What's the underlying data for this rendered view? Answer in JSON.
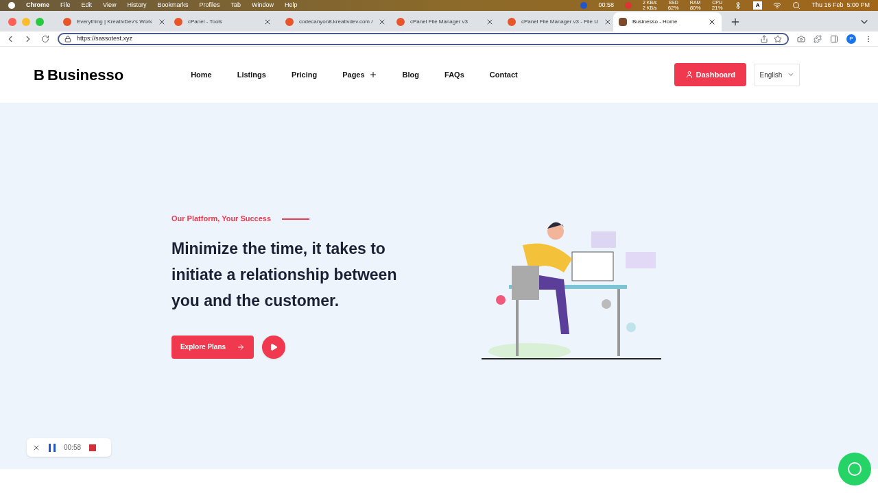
{
  "menu_bar": {
    "app": "Chrome",
    "menus": [
      "File",
      "Edit",
      "View",
      "History",
      "Bookmarks",
      "Profiles",
      "Tab",
      "Window",
      "Help"
    ],
    "timer": "00:58",
    "network": [
      "2 KB/s",
      "2 KB/s"
    ],
    "stats": [
      {
        "label": "SSD",
        "value": "62%"
      },
      {
        "label": "RAM",
        "value": "80%"
      },
      {
        "label": "CPU",
        "value": "21%"
      }
    ],
    "input_source": "A",
    "clock": "Thu 16 Feb  5:00 PM"
  },
  "tabs": [
    {
      "title": "Everything | KreativDev's Work",
      "selected": false
    },
    {
      "title": "cPanel - Tools",
      "selected": false
    },
    {
      "title": "codecanyon8.kreativdev.com /",
      "selected": false
    },
    {
      "title": "cPanel File Manager v3",
      "selected": false
    },
    {
      "title": "cPanel File Manager v3 - File U",
      "selected": false
    },
    {
      "title": "Businesso - Home",
      "selected": true
    }
  ],
  "address_bar": {
    "url": "https://sassotest.xyz",
    "profile": "P"
  },
  "site_header": {
    "logo_mark": "B",
    "logo_text": "Businesso",
    "nav": [
      {
        "label": "Home",
        "has_submenu": false
      },
      {
        "label": "Listings",
        "has_submenu": false
      },
      {
        "label": "Pricing",
        "has_submenu": false
      },
      {
        "label": "Pages",
        "has_submenu": true
      },
      {
        "label": "Blog",
        "has_submenu": false
      },
      {
        "label": "FAQs",
        "has_submenu": false
      },
      {
        "label": "Contact",
        "has_submenu": false
      }
    ],
    "dashboard_button": "Dashboard",
    "language": "English"
  },
  "hero": {
    "eyebrow": "Our Platform, Your Success",
    "headline_lines": [
      "Minimize the time, it takes to",
      "initiate a relationship between",
      "you and the customer."
    ],
    "cta": "Explore Plans"
  },
  "recorder": {
    "time": "00:58"
  }
}
